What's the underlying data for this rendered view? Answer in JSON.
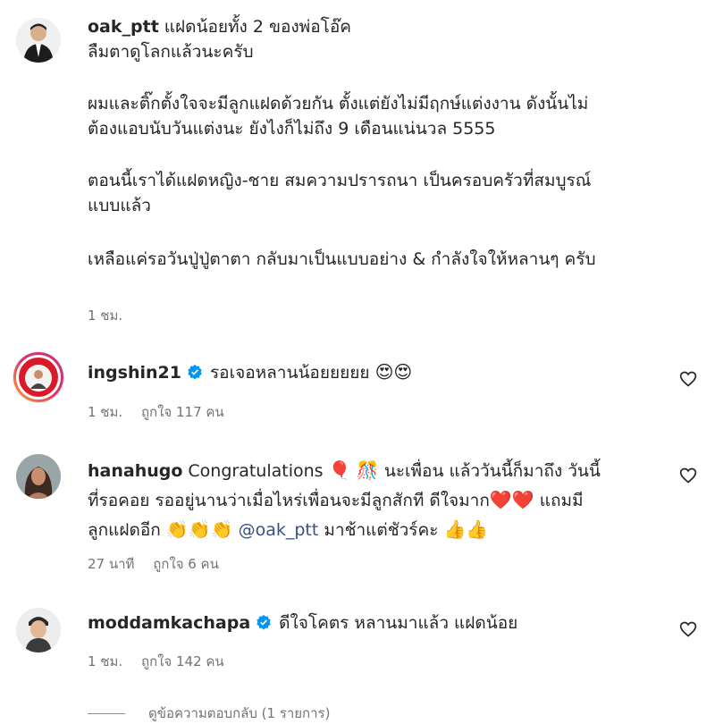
{
  "comments": [
    {
      "username": "oak_ptt",
      "first_line": "แฝดน้อยทั้ง 2 ของพ่อโอ๊ค",
      "paragraphs": [
        "ลืมตาดูโลกแล้วนะครับ",
        "",
        "ผมและติ๊กตั้งใจจะมีลูกแฝดด้วยกัน ตั้งแต่ยังไม่มีฤกษ์แต่งงาน ดังนั้นไม่\nต้องแอบนับวันแต่งนะ ยังไงก็ไม่ถึง 9 เดือนแน่นวล 5555",
        "",
        "ตอนนี้เราได้แฝดหญิง-ชาย สมความปรารถนา เป็นครอบครัวที่สมบูรณ์\nแบบแล้ว",
        "",
        "เหลือแค่รอวันปู่ปู่ตาตา กลับมาเป็นแบบอย่าง & กำลังใจให้หลานๆ ครับ"
      ],
      "time": "1 ชม."
    },
    {
      "username": "ingshin21",
      "text": "รอเจอหลานน้อยยยยย",
      "emoji": "😍😍",
      "time": "1 ชม.",
      "likes": "ถูกใจ 117 คน"
    },
    {
      "username": "hanahugo",
      "text_a": "Congratulations",
      "emoji_a": "🎈 🎊",
      "text_b": "นะเพื่อน แล้ววันนี้ก็มาถึง วันนี้",
      "line2": "ที่รอคอย รออยู่นานว่าเมื่อไหร่เพื่อนจะมีลูกสักที ดีใจมาก",
      "emoji_b": "❤️❤️",
      "text_c": "แถมมี",
      "line3a": "ลูกแฝดอีก",
      "emoji_c": "👏👏👏",
      "mention": "@oak_ptt",
      "line3b": "มาช้าแต่ชัวร์คะ",
      "emoji_d": "👍👍",
      "time": "27 นาที",
      "likes": "ถูกใจ 6 คน"
    },
    {
      "username": "moddamkachapa",
      "text": "ดีใจโคตร หลานมาแล้ว แฝดน้อย",
      "time": "1 ชม.",
      "likes": "ถูกใจ 142 คน"
    }
  ],
  "view_replies": "ดูข้อความตอบกลับ (1 รายการ)",
  "icons": {
    "verified": "verified-badge-icon",
    "heart": "heart-outline-icon"
  },
  "colors": {
    "verified": "#0095f6",
    "ring": "#e1306c",
    "meta": "#737373"
  }
}
